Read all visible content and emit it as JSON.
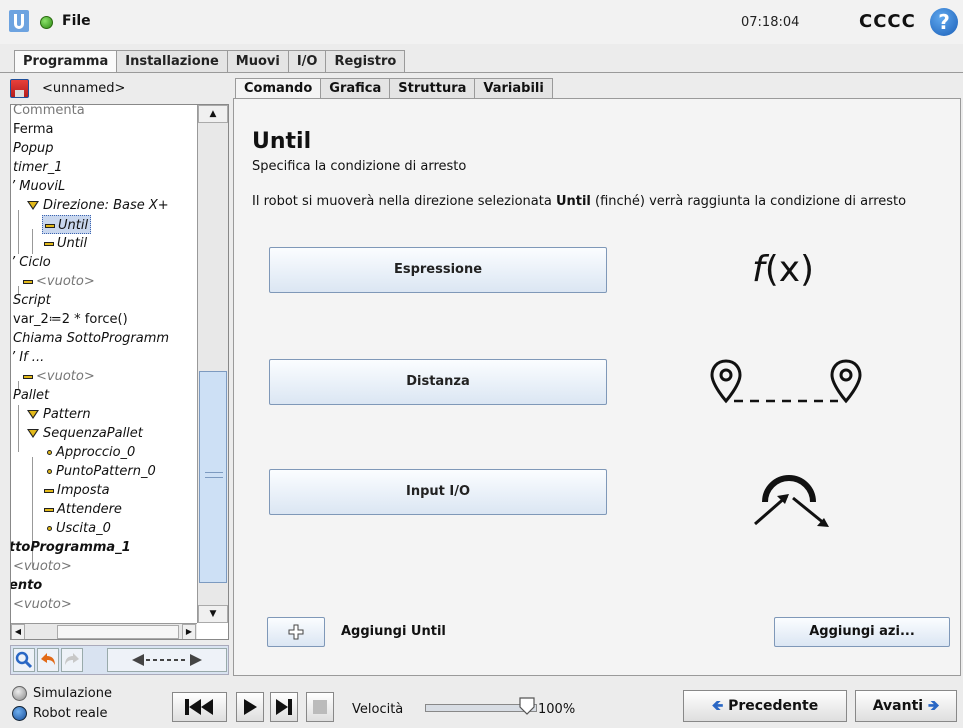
{
  "topbar": {
    "file_label": "File",
    "clock": "07:18:04",
    "robot_name": "CCCC",
    "help_glyph": "?"
  },
  "main_tabs": [
    "Programma",
    "Installazione",
    "Muovi",
    "I/O",
    "Registro"
  ],
  "program": {
    "name": "<unnamed>"
  },
  "tree": [
    {
      "label": "Commenta",
      "style": "grey"
    },
    {
      "label": "Ferma",
      "style": ""
    },
    {
      "label": "Popup",
      "style": "italic"
    },
    {
      "label": "timer_1",
      "style": "italic"
    },
    {
      "label": "’ MuoviL",
      "style": "italic"
    },
    {
      "label": "Direzione: Base X+",
      "style": "italic"
    },
    {
      "label": "Until",
      "style": "italic"
    },
    {
      "label": "Until",
      "style": "italic"
    },
    {
      "label": "’ Ciclo",
      "style": "italic"
    },
    {
      "label": "<vuoto>",
      "style": "grey"
    },
    {
      "label": "Script",
      "style": "italic"
    },
    {
      "label": "var_2≔2 * force()",
      "style": ""
    },
    {
      "label": "Chiama SottoProgramm",
      "style": "italic"
    },
    {
      "label": "’ If ...",
      "style": "italic"
    },
    {
      "label": "<vuoto>",
      "style": "grey"
    },
    {
      "label": "Pallet",
      "style": "italic"
    },
    {
      "label": "Pattern",
      "style": "italic"
    },
    {
      "label": "SequenzaPallet",
      "style": "italic"
    },
    {
      "label": "Approccio_0",
      "style": "italic"
    },
    {
      "label": "PuntoPattern_0",
      "style": "italic"
    },
    {
      "label": "Imposta",
      "style": "italic"
    },
    {
      "label": "Attendere",
      "style": "italic"
    },
    {
      "label": "Uscita_0",
      "style": "italic"
    },
    {
      "label": "ttoProgramma_1",
      "style": "bold"
    },
    {
      "label": "<vuoto>",
      "style": "grey"
    },
    {
      "label": "ento",
      "style": "bold"
    },
    {
      "label": "<vuoto>",
      "style": "grey"
    }
  ],
  "sub_tabs": [
    "Comando",
    "Grafica",
    "Struttura",
    "Variabili"
  ],
  "content": {
    "title": "Until",
    "subtitle": "Specifica la condizione di arresto",
    "desc_pre": "Il robot si muoverà nella direzione selezionata ",
    "desc_bold": "Until",
    "desc_post": " (finché) verrà raggiunta la condizione di arresto",
    "btn_expression": "Espressione",
    "btn_distance": "Distanza",
    "btn_io": "Input I/O",
    "fx_f": "f",
    "fx_x": "(x)",
    "add_until": "Aggiungi Until",
    "add_action": "Aggiungi azi..."
  },
  "bottom": {
    "mode_sim": "Simulazione",
    "mode_real": "Robot reale",
    "speed_label": "Velocità",
    "speed_value": "100%",
    "speed_fraction": 1.0,
    "prev": "Precedente",
    "next": "Avanti"
  },
  "colors": {
    "accent": "#2a67c4",
    "tree_icon": "#e2b91a",
    "selection": "#c9d7ee"
  }
}
